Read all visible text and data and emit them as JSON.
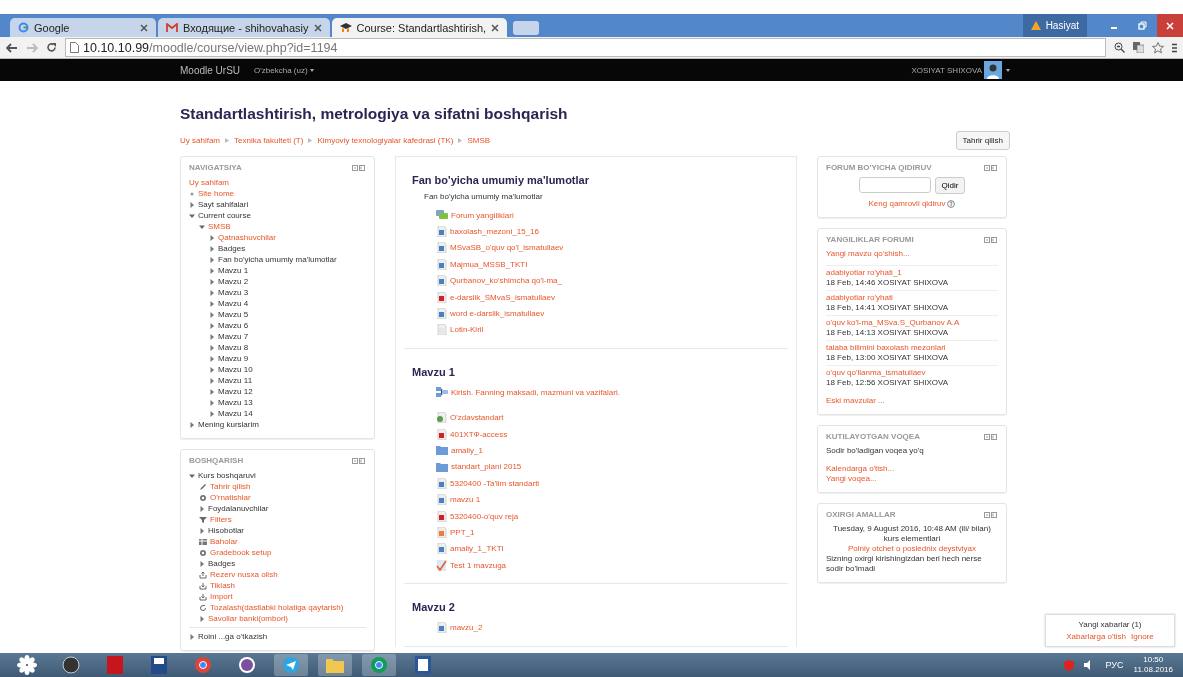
{
  "browser": {
    "tabs": [
      {
        "title": "Google",
        "selected": false,
        "kind": "search"
      },
      {
        "title": "Входящие - shihovahasiy",
        "selected": false,
        "kind": "mail"
      },
      {
        "title": "Course: Standartlashtirish,",
        "selected": true,
        "kind": "course"
      }
    ],
    "notice": "Hasiyat",
    "url": {
      "host": "10.10.10.99",
      "path": "/moodle/course/view.php?id=1194"
    }
  },
  "navbar": {
    "brand": "Moodle UrSU",
    "language": "O'zbekcha (uz)",
    "user": "XOSIYAT SHIXOVA"
  },
  "course": {
    "title": "Standartlashtirish, metrologiya va sifatni boshqarish",
    "breadcrumb": [
      "Uy sahifam",
      "Texnika fakulteti (T)",
      "Kimyoviy texnologiyalar kafedrasi (TK)",
      "SMSB"
    ],
    "edit_button": "Tahrir qilish"
  },
  "navigation": {
    "title": "NAVIGATSIYA",
    "items": [
      {
        "label": "Uy sahifam",
        "link": true,
        "kind": "root"
      },
      {
        "label": "Site home",
        "link": true,
        "kind": "leaf"
      },
      {
        "label": "Sayt sahifalari",
        "link": false,
        "kind": "branch",
        "expanded": false
      },
      {
        "label": "Current course",
        "link": false,
        "kind": "branch",
        "expanded": true,
        "children": [
          {
            "label": "SMSB",
            "link": true,
            "kind": "branch",
            "expanded": true,
            "children": [
              {
                "label": "Qatnashuvchilar",
                "link": true,
                "kind": "branch",
                "expanded": false
              },
              {
                "label": "Badges",
                "link": false,
                "kind": "branch",
                "expanded": false
              },
              {
                "label": "Fan bo'yicha umumiy ma'lumotlar",
                "link": false,
                "kind": "branch",
                "expanded": false
              },
              {
                "label": "Mavzu 1",
                "link": false,
                "kind": "branch",
                "expanded": false
              },
              {
                "label": "Mavzu 2",
                "link": false,
                "kind": "branch",
                "expanded": false
              },
              {
                "label": "Mavzu 3",
                "link": false,
                "kind": "branch",
                "expanded": false
              },
              {
                "label": "Mavzu 4",
                "link": false,
                "kind": "branch",
                "expanded": false
              },
              {
                "label": "Mavzu 5",
                "link": false,
                "kind": "branch",
                "expanded": false
              },
              {
                "label": "Mavzu 6",
                "link": false,
                "kind": "branch",
                "expanded": false
              },
              {
                "label": "Mavzu 7",
                "link": false,
                "kind": "branch",
                "expanded": false
              },
              {
                "label": "Mavzu 8",
                "link": false,
                "kind": "branch",
                "expanded": false
              },
              {
                "label": "Mavzu 9",
                "link": false,
                "kind": "branch",
                "expanded": false
              },
              {
                "label": "Mavzu 10",
                "link": false,
                "kind": "branch",
                "expanded": false
              },
              {
                "label": "Mavzu 11",
                "link": false,
                "kind": "branch",
                "expanded": false
              },
              {
                "label": "Mavzu 12",
                "link": false,
                "kind": "branch",
                "expanded": false
              },
              {
                "label": "Mavzu 13",
                "link": false,
                "kind": "branch",
                "expanded": false
              },
              {
                "label": "Mavzu 14",
                "link": false,
                "kind": "branch",
                "expanded": false
              }
            ]
          }
        ]
      },
      {
        "label": "Mening kurslarim",
        "link": false,
        "kind": "branch",
        "expanded": false
      }
    ]
  },
  "administration": {
    "title": "BOSHQARISH",
    "items": [
      {
        "label": "Kurs boshqaruvi",
        "link": false,
        "kind": "branch",
        "expanded": true,
        "children": [
          {
            "label": "Tahrir qilish",
            "link": true,
            "kind": "pencil"
          },
          {
            "label": "O'rnatishlar",
            "link": true,
            "kind": "gear"
          },
          {
            "label": "Foydalanuvchilar",
            "link": false,
            "kind": "branch",
            "expanded": false
          },
          {
            "label": "Filters",
            "link": true,
            "kind": "funnel"
          },
          {
            "label": "Hisobotlar",
            "link": false,
            "kind": "branch",
            "expanded": false
          },
          {
            "label": "Baholar",
            "link": true,
            "kind": "table"
          },
          {
            "label": "Gradebook setup",
            "link": true,
            "kind": "gear"
          },
          {
            "label": "Badges",
            "link": false,
            "kind": "branch",
            "expanded": false
          },
          {
            "label": "Rezerv nusxa olish",
            "link": true,
            "kind": "upload"
          },
          {
            "label": "Tiklash",
            "link": true,
            "kind": "download"
          },
          {
            "label": "Import",
            "link": true,
            "kind": "download"
          },
          {
            "label": "Tozalash(dastlabki holatiga qaytarish)",
            "link": true,
            "kind": "refresh"
          },
          {
            "label": "Savollar banki(ombori)",
            "link": true,
            "kind": "branch",
            "expanded": false
          }
        ]
      }
    ],
    "footer_item": {
      "label": "Roini ...ga o'tkazish",
      "link": false,
      "kind": "branch",
      "expanded": false
    }
  },
  "sections": [
    {
      "title": "Fan bo'yicha umumiy ma'lumotlar",
      "summary": "Fan bo'yicha umumiy ma'lumotlar",
      "activities": [
        {
          "label": "Forum yangiliklari",
          "kind": "forum"
        },
        {
          "label": "baxolash_mezoni_15_16",
          "kind": "word"
        },
        {
          "label": "MSvaSB_o'quv qo'l_ismatullaev",
          "kind": "word"
        },
        {
          "label": "Majmua_MSSB_TKTI",
          "kind": "word"
        },
        {
          "label": "Qurbanov_ko'shimcha qo'l-ma_",
          "kind": "word"
        },
        {
          "label": "e-darslik_SMvaS_ismatullaev",
          "kind": "pdf"
        },
        {
          "label": "word e-darslik_ismatullaev",
          "kind": "word"
        },
        {
          "label": "Lotin-Kiril",
          "kind": "blank"
        }
      ]
    },
    {
      "title": "Mavzu 1",
      "activities": [
        {
          "label": "Kirish. Fanning maksadi, mazmuni va vazifalari.",
          "kind": "book"
        },
        {
          "label": "O'zdavstandart",
          "kind": "url"
        },
        {
          "label": "401XTФ-access",
          "kind": "pdf"
        },
        {
          "label": "amaliy_1",
          "kind": "folder"
        },
        {
          "label": "standart_plani 2015",
          "kind": "folder"
        },
        {
          "label": "5320400 -Ta'lim standarti",
          "kind": "word"
        },
        {
          "label": "mavzu 1",
          "kind": "word"
        },
        {
          "label": "5320400-o'quv reja",
          "kind": "pdf"
        },
        {
          "label": "PPT_1",
          "kind": "ppt"
        },
        {
          "label": "amaliy_1_TKTI",
          "kind": "word"
        },
        {
          "label": "Test 1 mavzuga",
          "kind": "quiz"
        }
      ]
    },
    {
      "title": "Mavzu 2",
      "activities": [
        {
          "label": "mavzu_2",
          "kind": "word"
        }
      ]
    }
  ],
  "forum_search": {
    "title": "FORUM BO'YICHA QIDIRUV",
    "button": "Qidir",
    "advanced_link": "Keng qamrovli qidiruv"
  },
  "news_forum": {
    "title": "YANGILIKLAR FORUMI",
    "add_link": "Yangi mavzu qo'shish...",
    "posts": [
      {
        "title": "adabiyotlar ro'yhati_1",
        "meta": "18 Feb, 14:46 XOSIYAT SHIXOVA"
      },
      {
        "title": "adabiyotlar ro'yhati",
        "meta": "18 Feb, 14:41 XOSIYAT SHIXOVA"
      },
      {
        "title": "o'quv ko'l-ma_MSva.S_Qurbanov A.A",
        "meta": "18 Feb, 14:13 XOSIYAT SHIXOVA"
      },
      {
        "title": "talaba bilimini baxolash mezonlari",
        "meta": "18 Feb, 13:00 XOSIYAT SHIXOVA"
      },
      {
        "title": "o'quv qo'llanma_ismatullaev",
        "meta": "18 Feb, 12:56 XOSIYAT SHIXOVA"
      }
    ],
    "older_link": "Eski mavzular ..."
  },
  "upcoming_events": {
    "title": "KUTILAYOTGAN VOQEA",
    "text": "Sodir bo'ladigan voqea yo'q",
    "links": [
      "Kalendarga o'tish...",
      "Yangi voqea..."
    ]
  },
  "recent_activity": {
    "title": "OXIRGI AMALLAR",
    "since": "Tuesday, 9 August 2016, 10:48 AM (ili/ bilan) kurs elementlari",
    "report_link": "Polniy otchet o poslednix deystviyax",
    "text": "Sizning oxirgi kirishingizdan beri hech nerse sodir bo'lmadi"
  },
  "message_popup": {
    "text": "Yangi xabarlar (1)",
    "links": [
      "Xabarlarga o'tish",
      "Ignore"
    ]
  },
  "taskbar": {
    "language": "РУС",
    "time": "10:50",
    "date": "11.08.2016"
  }
}
